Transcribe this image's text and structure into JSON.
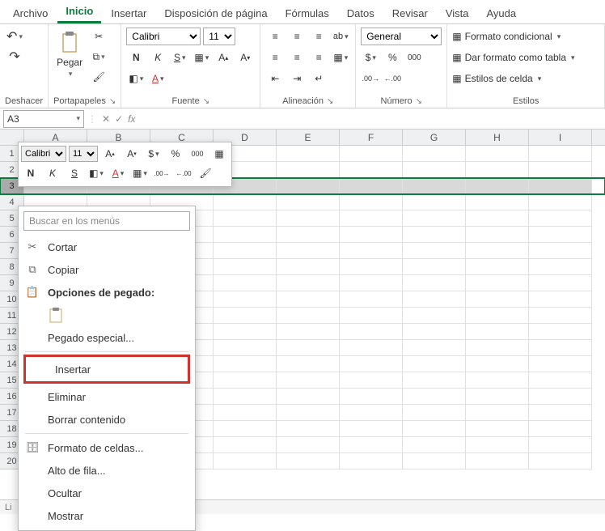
{
  "tabs": {
    "items": [
      "Archivo",
      "Inicio",
      "Insertar",
      "Disposición de página",
      "Fórmulas",
      "Datos",
      "Revisar",
      "Vista",
      "Ayuda"
    ],
    "active_index": 1
  },
  "ribbon": {
    "undo_group_label": "Deshacer",
    "clipboard": {
      "paste_label": "Pegar",
      "group_label": "Portapapeles"
    },
    "font": {
      "name": "Calibri",
      "size": "11",
      "bold": "N",
      "italic": "K",
      "underline": "S",
      "group_label": "Fuente"
    },
    "alignment": {
      "group_label": "Alineación",
      "wrap_glyph": "ab"
    },
    "number": {
      "format": "General",
      "group_label": "Número"
    },
    "styles": {
      "cond_format": "Formato condicional",
      "as_table": "Dar formato como tabla",
      "cell_styles": "Estilos de celda",
      "group_label": "Estilos"
    }
  },
  "namebox": {
    "ref": "A3"
  },
  "formula_bar": {
    "fx_label": "fx",
    "value": ""
  },
  "columns": [
    "A",
    "B",
    "C",
    "D",
    "E",
    "F",
    "G",
    "H",
    "I"
  ],
  "rows": [
    1,
    2,
    3,
    4,
    5,
    6,
    7,
    8,
    9,
    10,
    11,
    12,
    13,
    14,
    15,
    16,
    17,
    18,
    19,
    20
  ],
  "selected_row": 3,
  "mini_toolbar": {
    "font": "Calibri",
    "size": "11",
    "bold": "N",
    "italic": "K",
    "underline": "S",
    "currency": "$",
    "percent": "%"
  },
  "context_menu": {
    "search_placeholder": "Buscar en los menús",
    "cut": "Cortar",
    "copy": "Copiar",
    "paste_options": "Opciones de pegado:",
    "paste_special": "Pegado especial...",
    "insert": "Insertar",
    "delete": "Eliminar",
    "clear": "Borrar contenido",
    "format_cells": "Formato de celdas...",
    "row_height": "Alto de fila...",
    "hide": "Ocultar",
    "unhide": "Mostrar"
  },
  "statusbar": {
    "text": "Li"
  }
}
